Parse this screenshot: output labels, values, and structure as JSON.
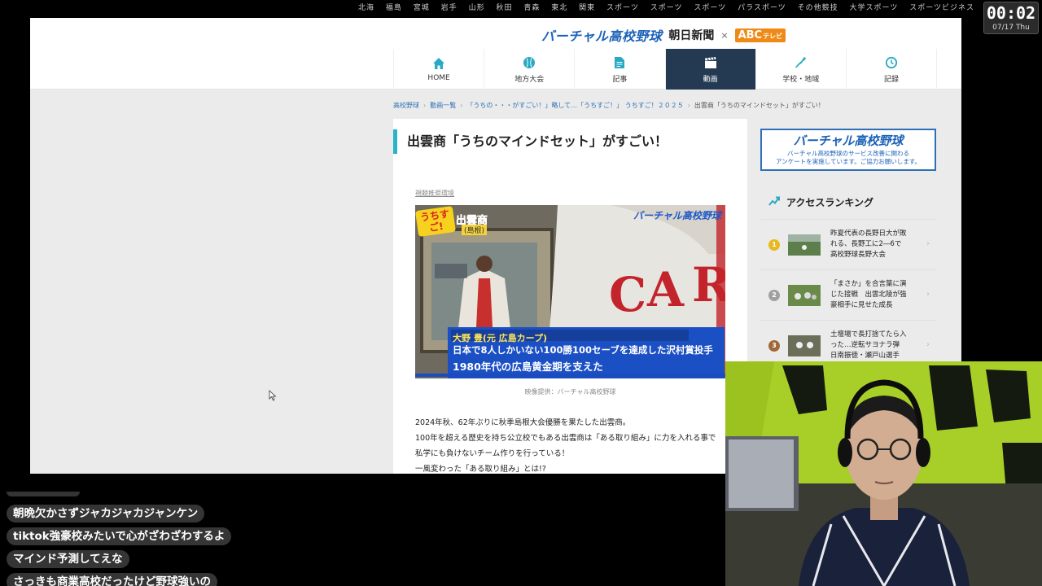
{
  "ticker": [
    "北海",
    "福島",
    "宮城",
    "岩手",
    "山形",
    "秋田",
    "青森",
    "東北",
    "関東",
    "スポーツ",
    "スポーツ",
    "スポーツ",
    "パラスポーツ",
    "その他競技",
    "大学スポーツ",
    "スポーツビジネス"
  ],
  "clock": {
    "time": "00:02",
    "date": "07/17 Thu"
  },
  "header": {
    "logo_vk": "バーチャル高校野球",
    "logo_asahi": "朝日新聞",
    "logo_x": "×",
    "logo_abc": "ABC",
    "logo_abc_sub": "テレビ"
  },
  "nav": [
    {
      "label": "HOME",
      "icon": "home-icon"
    },
    {
      "label": "地方大会",
      "icon": "baseball-icon"
    },
    {
      "label": "記事",
      "icon": "document-icon"
    },
    {
      "label": "動画",
      "icon": "clapperboard-icon",
      "active": true
    },
    {
      "label": "学校・地域",
      "icon": "map-icon"
    },
    {
      "label": "記録",
      "icon": "clock-icon"
    }
  ],
  "breadcrumb": {
    "items": [
      "高校野球",
      "動画一覧",
      "「うちの・・・がすごい！」略して…「うちすご！」 うちすご！２０２５"
    ],
    "current": "出雲商「うちのマインドセット」がすごい！",
    "separator": "›"
  },
  "article": {
    "title": "出雲商「うちのマインドセット」がすごい！",
    "rec_link": "視聴推奨環境",
    "video": {
      "badge": "うちすご!",
      "school": "出雲商",
      "prefecture": "(島根)",
      "watermark": "バーチャル高校野球",
      "name_line": "大野 豊(元 広島カープ)",
      "line1": "日本で8人しかいない100勝100セーブを達成した沢村賞投手",
      "line2": "1980年代の広島黄金期を支えた"
    },
    "caption": "映像提供：バーチャル高校野球",
    "body": [
      "2024年秋、62年ぶりに秋季島根大会優勝を果たした出雲商。",
      "100年を超える歴史を持ち公立校でもある出雲商は「ある取り組み」に力を入れる事で私学にも負けないチーム作りを行っている！",
      "一風変わった「ある取り組み」とは!?"
    ]
  },
  "sidebar": {
    "banner_title": "バーチャル高校野球",
    "banner_sub1": "バーチャル高校野球のサービス改善に関わる",
    "banner_sub2": "アンケートを実施しています。ご協力お願いします。",
    "ranking_title": "アクセスランキング",
    "ranking": [
      {
        "rank": "1",
        "color": "#e8b820",
        "text": "昨夏代表の長野日大が敗れる、長野工に2―6で 高校野球長野大会"
      },
      {
        "rank": "2",
        "color": "#a0a0a0",
        "text": "「まさか」を合言葉に演じた接戦　出雲北陵が強豪相手に見せた成長"
      },
      {
        "rank": "3",
        "color": "#a0683a",
        "text": "土壇場で長打捨てたら入った…逆転サヨナラ弾　日南振徳・瀬戸山選手"
      }
    ]
  },
  "chat": [
    "朝晩欠かさずジャカジャカジャンケン",
    "tiktok強豪校みたいで心がざわざわするよ",
    "マインド予測してえな",
    "さっきも商業高校だったけど野球強いの"
  ]
}
